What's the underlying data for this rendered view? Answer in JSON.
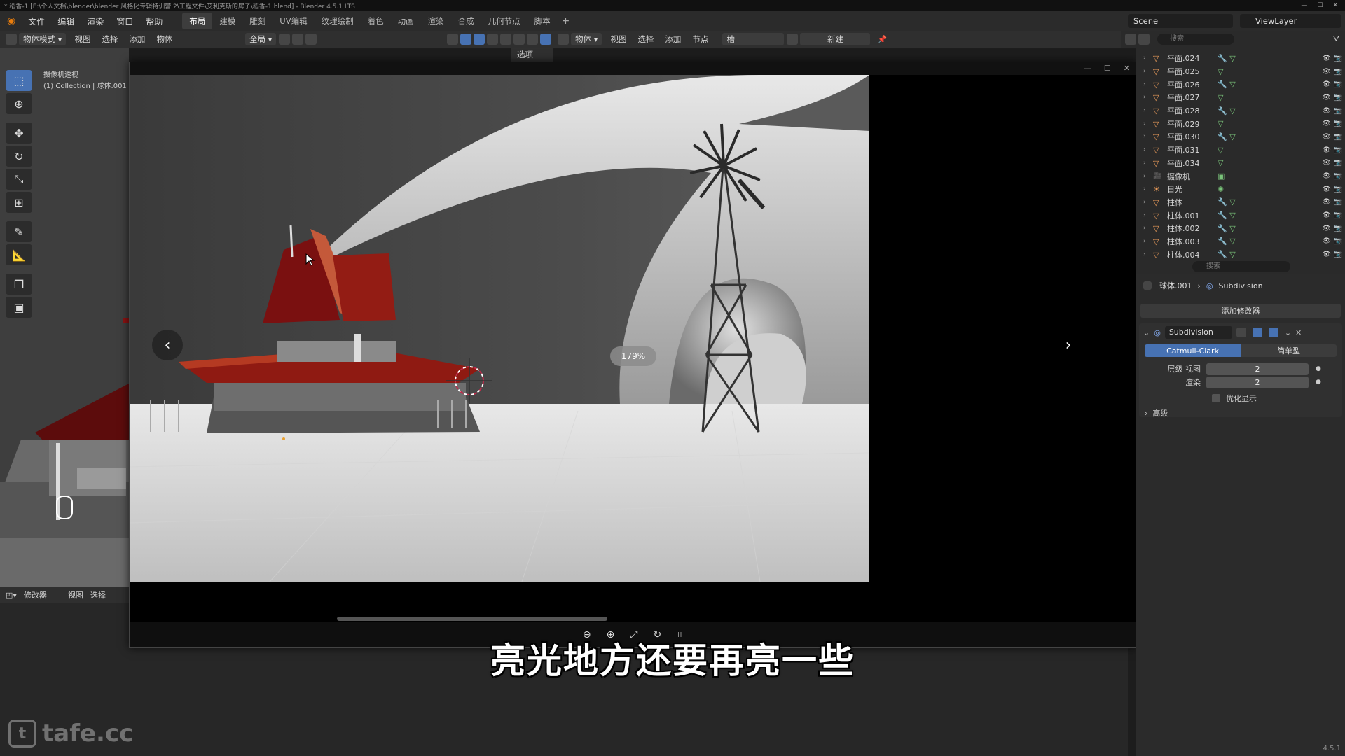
{
  "window_title": "* 稻香-1 [E:\\个人文档\\blender\\blender 风格化专辑特训营 2\\工程文件\\艾利克斯的房子\\稻香-1.blend] - Blender 4.5.1 LTS",
  "menu": [
    "文件",
    "编辑",
    "渲染",
    "窗口",
    "帮助"
  ],
  "workspace_tabs": [
    "布局",
    "建模",
    "雕刻",
    "UV编辑",
    "纹理绘制",
    "着色",
    "动画",
    "渲染",
    "合成",
    "几何节点",
    "脚本"
  ],
  "active_tab": "布局",
  "scene": "Scene",
  "view_layer": "ViewLayer",
  "viewport_header": {
    "mode": "物体模式",
    "items": [
      "视图",
      "选择",
      "添加",
      "物体"
    ],
    "transform": "全局"
  },
  "viewer_header": {
    "options": "选项"
  },
  "node_header": {
    "object": "物体",
    "items": [
      "视图",
      "选择",
      "添加",
      "节点"
    ],
    "slot": "槽",
    "new_button": "新建"
  },
  "viewport_info": {
    "line1": "摄像机透视",
    "line2": "(1) Collection | 球体.001"
  },
  "bottom_header": {
    "editor": "修改器",
    "items": [
      "视图",
      "选择"
    ]
  },
  "outliner": {
    "search_placeholder": "搜索",
    "rows": [
      {
        "name": "平面.024",
        "type": "mesh",
        "mods": "modifier+mesh"
      },
      {
        "name": "平面.025",
        "type": "mesh",
        "mods": "mesh"
      },
      {
        "name": "平面.026",
        "type": "mesh",
        "mods": "modifier+mesh"
      },
      {
        "name": "平面.027",
        "type": "mesh",
        "mods": "mesh"
      },
      {
        "name": "平面.028",
        "type": "mesh",
        "mods": "modifier+mesh"
      },
      {
        "name": "平面.029",
        "type": "mesh",
        "mods": "mesh"
      },
      {
        "name": "平面.030",
        "type": "mesh",
        "mods": "modifier+mesh"
      },
      {
        "name": "平面.031",
        "type": "mesh",
        "mods": "mesh"
      },
      {
        "name": "平面.034",
        "type": "mesh",
        "mods": "mesh"
      },
      {
        "name": "摄像机",
        "type": "camera",
        "mods": "camera"
      },
      {
        "name": "日光",
        "type": "light",
        "mods": "sun"
      },
      {
        "name": "柱体",
        "type": "mesh",
        "mods": "modifier+mesh"
      },
      {
        "name": "柱体.001",
        "type": "mesh",
        "mods": "modifier+mesh"
      },
      {
        "name": "柱体.002",
        "type": "mesh",
        "mods": "modifier+mesh"
      },
      {
        "name": "柱体.003",
        "type": "mesh",
        "mods": "modifier+mesh"
      },
      {
        "name": "柱体.004",
        "type": "mesh",
        "mods": "modifier+mesh"
      }
    ]
  },
  "properties": {
    "search_placeholder": "搜索",
    "object": "球体.001",
    "modifier_breadcrumb": "Subdivision",
    "add_modifier": "添加修改器",
    "modifier_name": "Subdivision",
    "mode_on": "Catmull-Clark",
    "mode_off": "简单型",
    "viewport_levels_label": "层级 视图",
    "viewport_levels": "2",
    "render_label": "渲染",
    "render_levels": "2",
    "optimal_display": "优化显示",
    "advanced": "高级"
  },
  "image_viewer": {
    "zoom": "179%"
  },
  "subtitle": "亮光地方还要再亮一些",
  "watermark": "tafe.cc",
  "version": "4.5.1",
  "colors": {
    "accent": "#4772b3",
    "roof_red": "#8f1a12",
    "background": "#1d1d1d"
  }
}
